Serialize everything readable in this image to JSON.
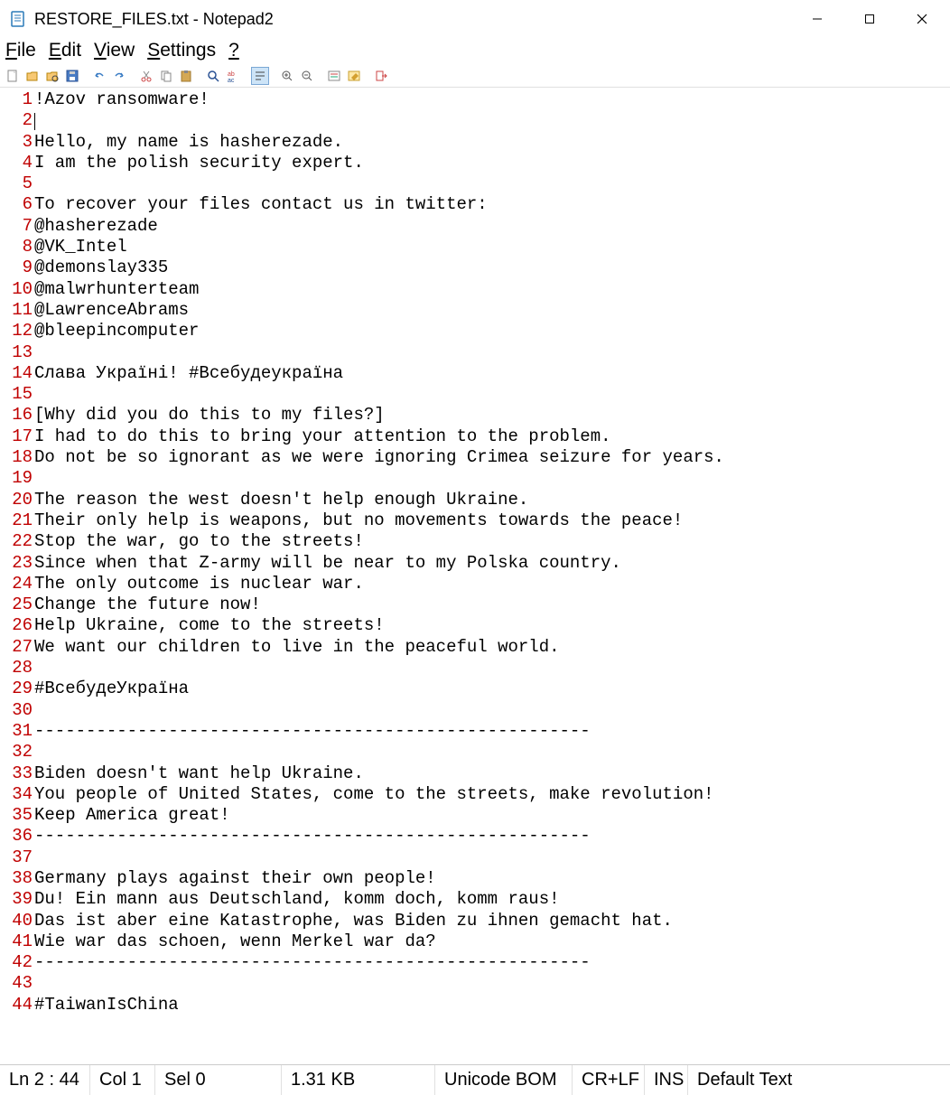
{
  "window": {
    "title": "RESTORE_FILES.txt - Notepad2"
  },
  "menu": {
    "file": "File",
    "edit": "Edit",
    "view": "View",
    "settings": "Settings",
    "help": "?"
  },
  "toolbar_icons": [
    "new-file-icon",
    "open-file-icon",
    "browse-icon",
    "save-icon",
    "undo-icon",
    "redo-icon",
    "cut-icon",
    "copy-icon",
    "paste-icon",
    "find-icon",
    "replace-icon",
    "word-wrap-icon",
    "zoom-in-icon",
    "zoom-out-icon",
    "scheme-icon",
    "custom-scheme-icon",
    "exit-icon"
  ],
  "lines": [
    "!Azov ransomware!",
    "",
    "Hello, my name is hasherezade.",
    "I am the polish security expert.",
    "",
    "To recover your files contact us in twitter:",
    "@hasherezade",
    "@VK_Intel",
    "@demonslay335",
    "@malwrhunterteam",
    "@LawrenceAbrams",
    "@bleepincomputer",
    "",
    "Слава Україні! #Всебудеукраїна",
    "",
    "[Why did you do this to my files?]",
    "I had to do this to bring your attention to the problem.",
    "Do not be so ignorant as we were ignoring Crimea seizure for years.",
    "",
    "The reason the west doesn't help enough Ukraine.",
    "Their only help is weapons, but no movements towards the peace!",
    "Stop the war, go to the streets!",
    "Since when that Z-army will be near to my Polska country.",
    "The only outcome is nuclear war.",
    "Change the future now!",
    "Help Ukraine, come to the streets!",
    "We want our children to live in the peaceful world.",
    "",
    "#ВсебудеУкраїна",
    "",
    "------------------------------------------------------",
    "",
    "Biden doesn't want help Ukraine.",
    "You people of United States, come to the streets, make revolution!",
    "Keep America great!",
    "------------------------------------------------------",
    "",
    "Germany plays against their own people!",
    "Du! Ein mann aus Deutschland, komm doch, komm raus!",
    "Das ist aber eine Katastrophe, was Biden zu ihnen gemacht hat.",
    "Wie war das schoen, wenn Merkel war da?",
    "------------------------------------------------------",
    "",
    "#TaiwanIsChina"
  ],
  "status": {
    "ln": "Ln 2 : 44",
    "col": "Col 1",
    "sel": "Sel 0",
    "size": "1.31 KB",
    "encoding": "Unicode BOM",
    "eol": "CR+LF",
    "mode": "INS",
    "scheme": "Default Text"
  }
}
